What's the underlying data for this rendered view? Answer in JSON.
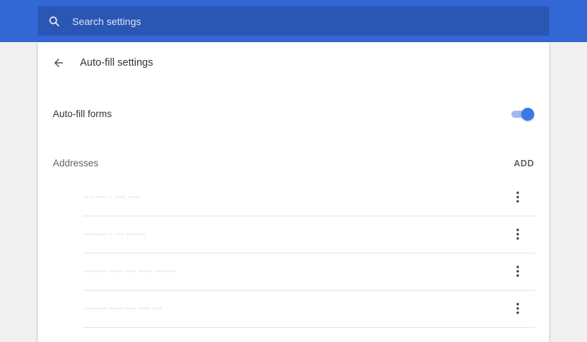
{
  "search": {
    "placeholder": "Search settings",
    "icon": "search-icon"
  },
  "header": {
    "title": "Auto-fill settings",
    "back_icon": "arrow-back-icon"
  },
  "autofill": {
    "label": "Auto-fill forms",
    "enabled": true
  },
  "addresses": {
    "label": "Addresses",
    "add_label": "ADD",
    "items": [
      {
        "text": "‧‧ ‧ ‧‧‧‧‧ ‧ ‧‧‧‧‧ ‧‧‧‧‧"
      },
      {
        "text": "‧‧‧‧‧‧‧‧‧ ‧‧ ‧‧‧‧ ‧‧‧‧‧‧‧‧"
      },
      {
        "text": "‧‧‧‧‧‧‧‧‧‧ ‧‧‧‧‧‧ ‧‧‧‧ ‧‧‧‧‧‧ ‧‧‧‧‧‧‧‧‧"
      },
      {
        "text": "‧‧‧‧‧‧‧‧‧‧ ‧‧‧‧‧‧ ‧‧‧‧ ‧‧‧‧‧ ‧‧‧‧"
      }
    ]
  },
  "colors": {
    "topbar": "#3367d6",
    "search_bg": "#2a56b4",
    "toggle_knob": "#3b78e7",
    "toggle_track": "#9fbbf1"
  }
}
